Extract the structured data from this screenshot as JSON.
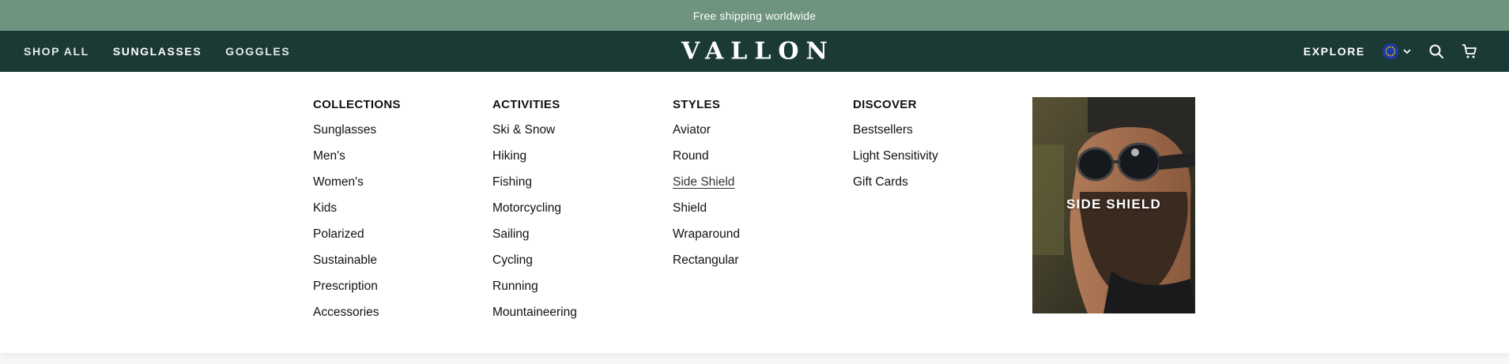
{
  "announcement": "Free shipping worldwide",
  "header": {
    "nav_left": [
      "SHOP ALL",
      "SUNGLASSES",
      "GOGGLES"
    ],
    "logo": "VALLON",
    "explore": "EXPLORE",
    "icons": [
      "eu-flag-icon",
      "chevron-down-icon",
      "search-icon",
      "cart-icon"
    ]
  },
  "menu": {
    "columns": [
      {
        "heading": "COLLECTIONS",
        "items": [
          "Sunglasses",
          "Men's",
          "Women's",
          "Kids",
          "Polarized",
          "Sustainable",
          "Prescription",
          "Accessories"
        ]
      },
      {
        "heading": "ACTIVITIES",
        "items": [
          "Ski & Snow",
          "Hiking",
          "Fishing",
          "Motorcycling",
          "Sailing",
          "Cycling",
          "Running",
          "Mountaineering"
        ]
      },
      {
        "heading": "STYLES",
        "items": [
          "Aviator",
          "Round",
          "Side Shield",
          "Shield",
          "Wraparound",
          "Rectangular"
        ]
      },
      {
        "heading": "DISCOVER",
        "items": [
          "Bestsellers",
          "Light Sensitivity",
          "Gift Cards"
        ]
      }
    ],
    "active_item": "Side Shield",
    "promo_label": "SIDE SHIELD"
  },
  "colors": {
    "announcement_bg": "#6e937f",
    "header_bg": "#1b3a35"
  }
}
